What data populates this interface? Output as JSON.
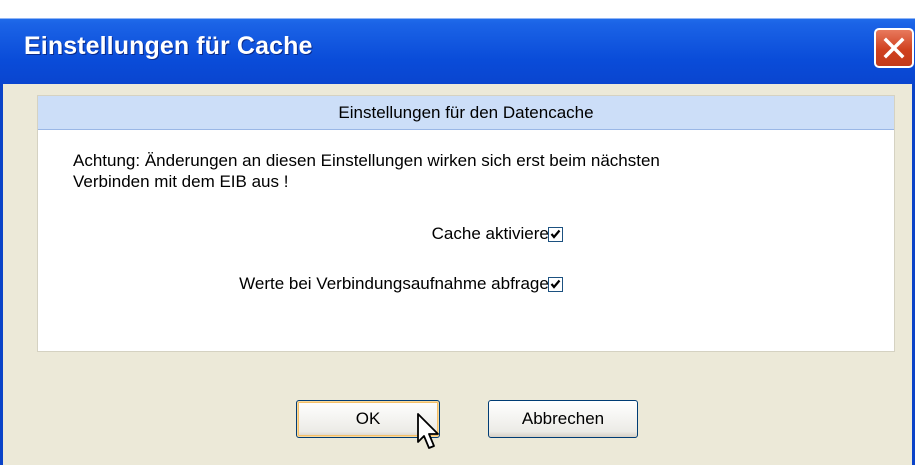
{
  "window": {
    "title": "Einstellungen für Cache"
  },
  "panel": {
    "header": "Einstellungen für den Datencache",
    "warning_line1": "Achtung: Änderungen an diesen Einstellungen wirken sich erst beim nächsten",
    "warning_line2": "Verbinden mit dem EIB aus !",
    "options": [
      {
        "label": "Cache aktivieren:",
        "checked": true
      },
      {
        "label": "Werte bei Verbindungsaufnahme abfragen:",
        "checked": true
      }
    ]
  },
  "buttons": {
    "ok_label": "OK",
    "cancel_label": "Abbrechen"
  },
  "icons": {
    "close": "close-icon",
    "check": "checkmark-icon",
    "cursor": "mouse-pointer-icon"
  },
  "colors": {
    "titlebar": "#0a4cd9",
    "close_button": "#d0411f",
    "panel_header": "#ccdef8",
    "window_background": "#ece9d8"
  }
}
